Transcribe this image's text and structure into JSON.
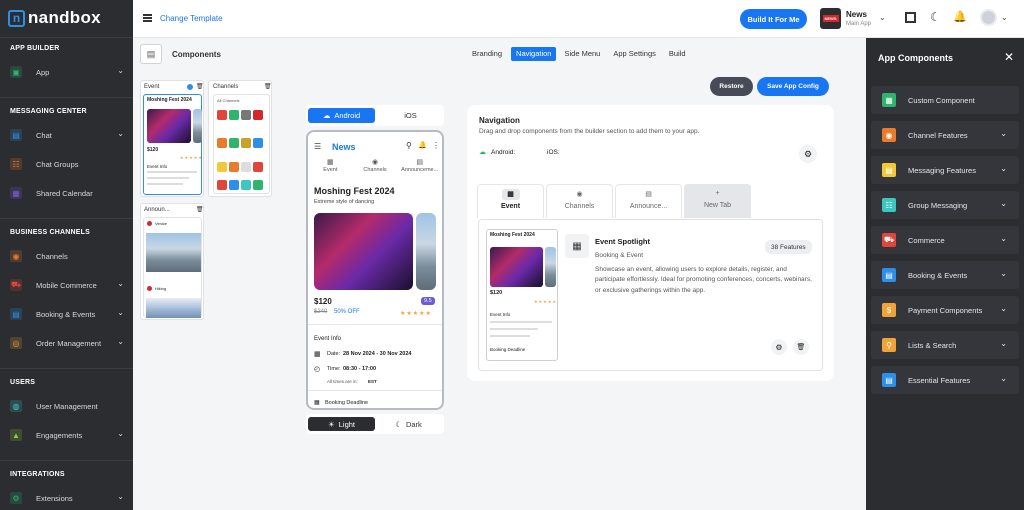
{
  "brand": {
    "name": "nandbox",
    "mark": "n"
  },
  "sidebar": {
    "sections": [
      {
        "title": "APP BUILDER",
        "items": [
          {
            "label": "App",
            "icon": "app-icon",
            "color": "#2fb36d",
            "chev": true
          }
        ]
      },
      {
        "title": "MESSAGING CENTER",
        "items": [
          {
            "label": "Chat",
            "icon": "chat-icon",
            "color": "#2e8fe8",
            "chev": true
          },
          {
            "label": "Chat Groups",
            "icon": "chat-groups-icon",
            "color": "#e97b2e",
            "chev": false
          },
          {
            "label": "Shared Calendar",
            "icon": "calendar-icon",
            "color": "#7b5bd6",
            "chev": false
          }
        ]
      },
      {
        "title": "BUSINESS CHANNELS",
        "items": [
          {
            "label": "Channels",
            "icon": "rss-icon",
            "color": "#e97b2e",
            "chev": false
          },
          {
            "label": "Mobile Commerce",
            "icon": "cart-icon",
            "color": "#e0463c",
            "chev": true
          },
          {
            "label": "Booking & Events",
            "icon": "booking-icon",
            "color": "#2e8fe8",
            "chev": true
          },
          {
            "label": "Order Management",
            "icon": "order-icon",
            "color": "#f0a23b",
            "chev": true
          }
        ]
      },
      {
        "title": "USERS",
        "items": [
          {
            "label": "User Management",
            "icon": "user-management-icon",
            "color": "#3cc8c0",
            "chev": false
          },
          {
            "label": "Engagements",
            "icon": "thumbs-up-icon",
            "color": "#8fcf3a",
            "chev": true
          }
        ]
      },
      {
        "title": "INTEGRATIONS",
        "items": [
          {
            "label": "Extensions",
            "icon": "extensions-icon",
            "color": "#2fb36d",
            "chev": true
          }
        ]
      }
    ]
  },
  "topbar": {
    "change_template": "Change Template",
    "build_btn": "Build It For Me",
    "app_name": "News",
    "app_sub": "Main App"
  },
  "components_label": "Components",
  "main_tabs": [
    {
      "label": "Branding",
      "active": false
    },
    {
      "label": "Navigation",
      "active": true
    },
    {
      "label": "Side Menu",
      "active": false
    },
    {
      "label": "App Settings",
      "active": false
    },
    {
      "label": "Build",
      "active": false
    }
  ],
  "actions": {
    "restore": "Restore",
    "save": "Save App Config"
  },
  "thumbnails": {
    "event": {
      "title": "Event",
      "name": "Moshing Fest 2024",
      "price": "$120",
      "info": "Event Info"
    },
    "channels": {
      "title": "Channels",
      "all": "All Channels"
    },
    "announcements": {
      "title": "Announ...",
      "label1": "Venice",
      "label2": "Hiking"
    }
  },
  "preview": {
    "platform_android": "Android",
    "platform_ios": "iOS",
    "app_title": "News",
    "tabs": [
      "Event",
      "Channels",
      "Announceme..."
    ],
    "event_title": "Moshing Fest 2024",
    "event_sub": "Extreme style of dancing",
    "price": "$120",
    "old_price": "$240",
    "discount": "50% OFF",
    "rating": "9.5",
    "stars": "★★★★★",
    "info_title": "Event Info",
    "date_label": "Date:",
    "date_value": "28 Nov 2024 - 30 Nov 2024",
    "time_label": "Time:",
    "time_value": "08:30 - 17:00",
    "tz_note": "All times are in:",
    "tz_value": "EST",
    "booking": "Booking Deadline",
    "theme_light": "Light",
    "theme_dark": "Dark"
  },
  "navigation": {
    "title": "Navigation",
    "desc": "Drag and drop components from the builder section to add them to your app.",
    "android": "Android:",
    "ios": "iOS:",
    "tabs": [
      {
        "label": "Event",
        "active": true
      },
      {
        "label": "Channels",
        "active": false
      },
      {
        "label": "Announce...",
        "active": false
      },
      {
        "label": "New Tab",
        "active": false
      }
    ],
    "card": {
      "mini_title": "Moshing Fest 2024",
      "mini_price": "$120",
      "mini_info": "Event Info",
      "mini_booking": "Booking Deadline",
      "name": "Event Spotlight",
      "category": "Booking & Event",
      "badge": "38 Features",
      "desc": "Showcase an event, allowing users to explore details, register, and participate effortlessly. Ideal for promoting conferences, concerts, webinars, or exclusive gatherings within the app."
    }
  },
  "right_panel": {
    "title": "App Components",
    "items": [
      {
        "label": "Custom Component",
        "icon": "custom-component-icon",
        "color": "#2fb36d",
        "chev": false
      },
      {
        "label": "Channel Features",
        "icon": "rss-icon",
        "color": "#e97b2e",
        "chev": true
      },
      {
        "label": "Messaging Features",
        "icon": "message-icon",
        "color": "#f0c93b",
        "chev": true
      },
      {
        "label": "Group Messaging",
        "icon": "group-icon",
        "color": "#3cc8c0",
        "chev": true
      },
      {
        "label": "Commerce",
        "icon": "cart-icon",
        "color": "#e0463c",
        "chev": true
      },
      {
        "label": "Booking & Events",
        "icon": "booking-icon",
        "color": "#2e8fe8",
        "chev": true
      },
      {
        "label": "Payment Components",
        "icon": "payment-icon",
        "color": "#f0a23b",
        "chev": true
      },
      {
        "label": "Lists & Search",
        "icon": "search-icon",
        "color": "#f0a23b",
        "chev": true
      },
      {
        "label": "Essential Features",
        "icon": "essential-icon",
        "color": "#2e8fe8",
        "chev": true
      }
    ]
  }
}
